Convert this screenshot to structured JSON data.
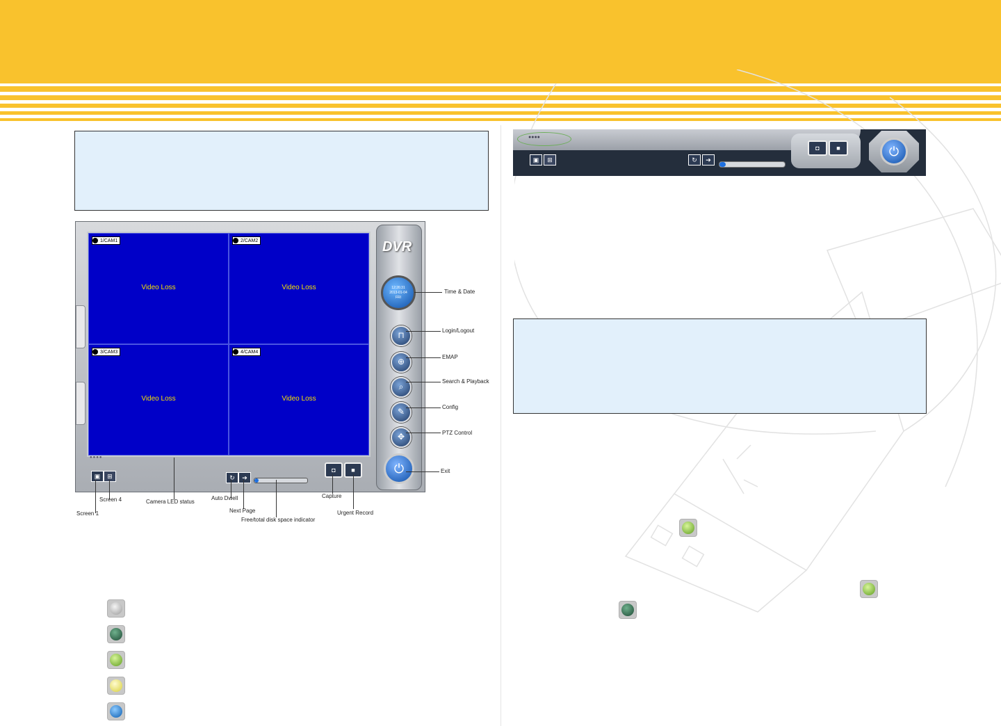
{
  "dvr": {
    "cameras": [
      {
        "label": "1/CAM1",
        "status": "Video Loss"
      },
      {
        "label": "2/CAM2",
        "status": "Video Loss"
      },
      {
        "label": "3/CAM3",
        "status": "Video Loss"
      },
      {
        "label": "4/CAM4",
        "status": "Video Loss"
      }
    ],
    "logo": "DVR",
    "clock_time": "12:26:31",
    "clock_date": "2013-01-04",
    "clock_day": "FRI",
    "led_dots": "●●●●"
  },
  "callouts": {
    "time_date": "Time & Date",
    "login_logout": "Login/Logout",
    "emap": "EMAP",
    "search_playback": "Search & Playback",
    "config": "Config",
    "ptz_control": "PTZ Control",
    "exit": "Exit",
    "screen4": "Screen 4",
    "camera_led_status": "Camera LED status",
    "auto_dwell": "Auto Dwell",
    "next_page": "Next Page",
    "disk_indicator": "Free/total disk space indicator",
    "capture": "Capture",
    "urgent_record": "Urgent Record",
    "screen1": "Screen 1"
  },
  "crop": {
    "led_dots": "●●●●"
  },
  "colors": {
    "header": "#f9c22d",
    "note_box": "#e2f0fb",
    "video_bg": "#0000c8",
    "led_gray": "#d0d0d0",
    "led_dark_green": "#2f6b4c",
    "led_green": "#8fcf3c",
    "led_yellow": "#f2ec6c",
    "led_blue": "#1e7fd6"
  },
  "icons": {
    "login": "lock-icon",
    "emap": "map-icon",
    "search": "search-icon",
    "config": "wrench-icon",
    "ptz": "ptz-icon",
    "exit": "power-icon",
    "auto_dwell": "refresh-icon",
    "next_page": "arrow-right-icon",
    "capture": "camera-icon",
    "urgent_record": "record-icon"
  }
}
